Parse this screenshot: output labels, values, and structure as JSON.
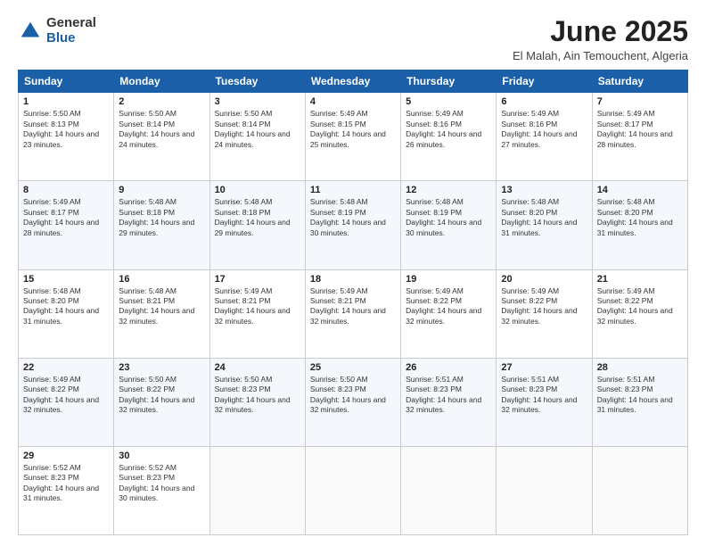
{
  "header": {
    "logo_general": "General",
    "logo_blue": "Blue",
    "month_title": "June 2025",
    "location": "El Malah, Ain Temouchent, Algeria"
  },
  "calendar": {
    "headers": [
      "Sunday",
      "Monday",
      "Tuesday",
      "Wednesday",
      "Thursday",
      "Friday",
      "Saturday"
    ],
    "weeks": [
      [
        {
          "day": "",
          "empty": true
        },
        {
          "day": "2",
          "sunrise": "Sunrise: 5:50 AM",
          "sunset": "Sunset: 8:14 PM",
          "daylight": "Daylight: 14 hours and 24 minutes."
        },
        {
          "day": "3",
          "sunrise": "Sunrise: 5:50 AM",
          "sunset": "Sunset: 8:14 PM",
          "daylight": "Daylight: 14 hours and 24 minutes."
        },
        {
          "day": "4",
          "sunrise": "Sunrise: 5:49 AM",
          "sunset": "Sunset: 8:15 PM",
          "daylight": "Daylight: 14 hours and 25 minutes."
        },
        {
          "day": "5",
          "sunrise": "Sunrise: 5:49 AM",
          "sunset": "Sunset: 8:16 PM",
          "daylight": "Daylight: 14 hours and 26 minutes."
        },
        {
          "day": "6",
          "sunrise": "Sunrise: 5:49 AM",
          "sunset": "Sunset: 8:16 PM",
          "daylight": "Daylight: 14 hours and 27 minutes."
        },
        {
          "day": "7",
          "sunrise": "Sunrise: 5:49 AM",
          "sunset": "Sunset: 8:17 PM",
          "daylight": "Daylight: 14 hours and 28 minutes."
        }
      ],
      [
        {
          "day": "8",
          "sunrise": "Sunrise: 5:49 AM",
          "sunset": "Sunset: 8:17 PM",
          "daylight": "Daylight: 14 hours and 28 minutes."
        },
        {
          "day": "9",
          "sunrise": "Sunrise: 5:48 AM",
          "sunset": "Sunset: 8:18 PM",
          "daylight": "Daylight: 14 hours and 29 minutes."
        },
        {
          "day": "10",
          "sunrise": "Sunrise: 5:48 AM",
          "sunset": "Sunset: 8:18 PM",
          "daylight": "Daylight: 14 hours and 29 minutes."
        },
        {
          "day": "11",
          "sunrise": "Sunrise: 5:48 AM",
          "sunset": "Sunset: 8:19 PM",
          "daylight": "Daylight: 14 hours and 30 minutes."
        },
        {
          "day": "12",
          "sunrise": "Sunrise: 5:48 AM",
          "sunset": "Sunset: 8:19 PM",
          "daylight": "Daylight: 14 hours and 30 minutes."
        },
        {
          "day": "13",
          "sunrise": "Sunrise: 5:48 AM",
          "sunset": "Sunset: 8:20 PM",
          "daylight": "Daylight: 14 hours and 31 minutes."
        },
        {
          "day": "14",
          "sunrise": "Sunrise: 5:48 AM",
          "sunset": "Sunset: 8:20 PM",
          "daylight": "Daylight: 14 hours and 31 minutes."
        }
      ],
      [
        {
          "day": "15",
          "sunrise": "Sunrise: 5:48 AM",
          "sunset": "Sunset: 8:20 PM",
          "daylight": "Daylight: 14 hours and 31 minutes."
        },
        {
          "day": "16",
          "sunrise": "Sunrise: 5:48 AM",
          "sunset": "Sunset: 8:21 PM",
          "daylight": "Daylight: 14 hours and 32 minutes."
        },
        {
          "day": "17",
          "sunrise": "Sunrise: 5:49 AM",
          "sunset": "Sunset: 8:21 PM",
          "daylight": "Daylight: 14 hours and 32 minutes."
        },
        {
          "day": "18",
          "sunrise": "Sunrise: 5:49 AM",
          "sunset": "Sunset: 8:21 PM",
          "daylight": "Daylight: 14 hours and 32 minutes."
        },
        {
          "day": "19",
          "sunrise": "Sunrise: 5:49 AM",
          "sunset": "Sunset: 8:22 PM",
          "daylight": "Daylight: 14 hours and 32 minutes."
        },
        {
          "day": "20",
          "sunrise": "Sunrise: 5:49 AM",
          "sunset": "Sunset: 8:22 PM",
          "daylight": "Daylight: 14 hours and 32 minutes."
        },
        {
          "day": "21",
          "sunrise": "Sunrise: 5:49 AM",
          "sunset": "Sunset: 8:22 PM",
          "daylight": "Daylight: 14 hours and 32 minutes."
        }
      ],
      [
        {
          "day": "22",
          "sunrise": "Sunrise: 5:49 AM",
          "sunset": "Sunset: 8:22 PM",
          "daylight": "Daylight: 14 hours and 32 minutes."
        },
        {
          "day": "23",
          "sunrise": "Sunrise: 5:50 AM",
          "sunset": "Sunset: 8:22 PM",
          "daylight": "Daylight: 14 hours and 32 minutes."
        },
        {
          "day": "24",
          "sunrise": "Sunrise: 5:50 AM",
          "sunset": "Sunset: 8:23 PM",
          "daylight": "Daylight: 14 hours and 32 minutes."
        },
        {
          "day": "25",
          "sunrise": "Sunrise: 5:50 AM",
          "sunset": "Sunset: 8:23 PM",
          "daylight": "Daylight: 14 hours and 32 minutes."
        },
        {
          "day": "26",
          "sunrise": "Sunrise: 5:51 AM",
          "sunset": "Sunset: 8:23 PM",
          "daylight": "Daylight: 14 hours and 32 minutes."
        },
        {
          "day": "27",
          "sunrise": "Sunrise: 5:51 AM",
          "sunset": "Sunset: 8:23 PM",
          "daylight": "Daylight: 14 hours and 32 minutes."
        },
        {
          "day": "28",
          "sunrise": "Sunrise: 5:51 AM",
          "sunset": "Sunset: 8:23 PM",
          "daylight": "Daylight: 14 hours and 31 minutes."
        }
      ],
      [
        {
          "day": "29",
          "sunrise": "Sunrise: 5:52 AM",
          "sunset": "Sunset: 8:23 PM",
          "daylight": "Daylight: 14 hours and 31 minutes."
        },
        {
          "day": "30",
          "sunrise": "Sunrise: 5:52 AM",
          "sunset": "Sunset: 8:23 PM",
          "daylight": "Daylight: 14 hours and 30 minutes."
        },
        {
          "day": "",
          "empty": true
        },
        {
          "day": "",
          "empty": true
        },
        {
          "day": "",
          "empty": true
        },
        {
          "day": "",
          "empty": true
        },
        {
          "day": "",
          "empty": true
        }
      ]
    ],
    "week0_day1": {
      "day": "1",
      "sunrise": "Sunrise: 5:50 AM",
      "sunset": "Sunset: 8:13 PM",
      "daylight": "Daylight: 14 hours and 23 minutes."
    }
  }
}
